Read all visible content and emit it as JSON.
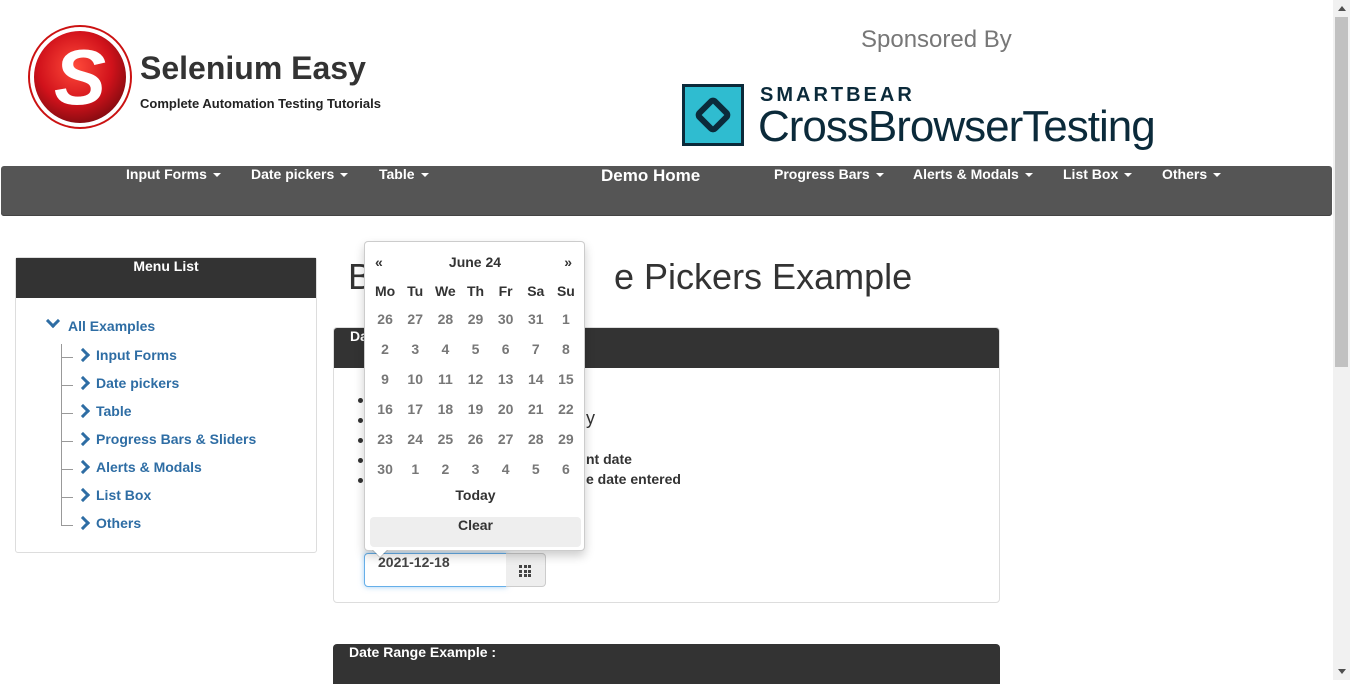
{
  "header": {
    "brand_title": "Selenium Easy",
    "brand_subtitle": "Complete Automation Testing Tutorials",
    "logo_letter": "S",
    "sponsored_label": "Sponsored By",
    "sponsor_brand": "SMARTBEAR",
    "sponsor_product": "CrossBrowserTesting"
  },
  "nav": {
    "items": [
      "Input Forms",
      "Date pickers",
      "Table",
      "Demo Home",
      "Progress Bars",
      "Alerts & Modals",
      "List Box",
      "Others"
    ],
    "bg_color": "#555555"
  },
  "sidebar": {
    "title": "Menu List",
    "root": "All Examples",
    "items": [
      "Input Forms",
      "Date pickers",
      "Table",
      "Progress Bars & Sliders",
      "Alerts & Modals",
      "List Box",
      "Others"
    ]
  },
  "main": {
    "heading_left": "B",
    "heading_right": "e Pickers Example",
    "panel_title": "Da",
    "bullet_fragments": [
      "",
      "y",
      "",
      "nt date",
      "e date entered"
    ],
    "date_value": "2021-12-18",
    "panel2_title": "Date Range Example :"
  },
  "datepicker": {
    "prev": "«",
    "next": "»",
    "month_label": "June 24",
    "weekdays": [
      "Mo",
      "Tu",
      "We",
      "Th",
      "Fr",
      "Sa",
      "Su"
    ],
    "weeks": [
      [
        "26",
        "27",
        "28",
        "29",
        "30",
        "31",
        "1"
      ],
      [
        "2",
        "3",
        "4",
        "5",
        "6",
        "7",
        "8"
      ],
      [
        "9",
        "10",
        "11",
        "12",
        "13",
        "14",
        "15"
      ],
      [
        "16",
        "17",
        "18",
        "19",
        "20",
        "21",
        "22"
      ],
      [
        "23",
        "24",
        "25",
        "26",
        "27",
        "28",
        "29"
      ],
      [
        "30",
        "1",
        "2",
        "3",
        "4",
        "5",
        "6"
      ]
    ],
    "today_label": "Today",
    "clear_label": "Clear"
  }
}
